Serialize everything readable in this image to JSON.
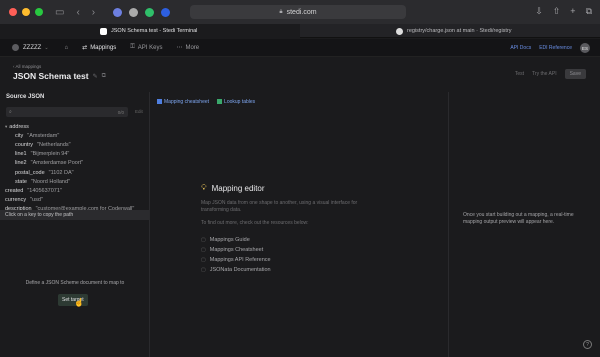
{
  "browser": {
    "url": "stedi.com",
    "tabs": [
      {
        "label": "JSON Schema test - Stedi Terminal"
      },
      {
        "label": "registry/charge.json at main · Stedi/registry"
      }
    ]
  },
  "app": {
    "org_name": "ZZZZZ",
    "nav": [
      {
        "label": "Mappings"
      },
      {
        "label": "API Keys"
      },
      {
        "label": "More"
      }
    ],
    "header_links": [
      {
        "label": "API Docs"
      },
      {
        "label": "EDI Reference"
      }
    ],
    "avatar_initials": "ES"
  },
  "page": {
    "breadcrumb": "All mappings",
    "title": "JSON Schema test",
    "actions": {
      "test": "Test",
      "try_api": "Try the API",
      "save": "Save"
    }
  },
  "source": {
    "title": "Source JSON",
    "search_count": "0/0",
    "edit": "Edit",
    "tree": [
      {
        "key": "address",
        "value": "",
        "level": 0,
        "caret": true
      },
      {
        "key": "city",
        "value": "\"Amsterdam\"",
        "level": 1
      },
      {
        "key": "country",
        "value": "\"Netherlands\"",
        "level": 1
      },
      {
        "key": "line1",
        "value": "\"Bijmerplein 94\"",
        "level": 1
      },
      {
        "key": "line2",
        "value": "\"Amsterdamse Poort\"",
        "level": 1
      },
      {
        "key": "postal_code",
        "value": "\"1102 DA\"",
        "level": 1
      },
      {
        "key": "state",
        "value": "\"Noord Holland\"",
        "level": 1
      },
      {
        "key": "created",
        "value": "\"1405637071\"",
        "level": 0
      },
      {
        "key": "currency",
        "value": "\"usd\"",
        "level": 0
      },
      {
        "key": "description",
        "value": "\"customer@example.com for Coderwall\"",
        "level": 0
      }
    ],
    "tooltip": "Click on a key to copy the path",
    "define_text": "Define a JSON Scheme document to map to",
    "set_target": "Set target"
  },
  "center": {
    "links": [
      {
        "label": "Mapping cheatsheet",
        "color": "#4f7fe0"
      },
      {
        "label": "Lookup tables",
        "color": "#3aa86b"
      }
    ],
    "editor_title": "Mapping editor",
    "editor_desc": "Map JSON data from one shape to another, using a visual interface for transforming data.",
    "editor_sub": "To find out more, check out the resources below:",
    "resources": [
      {
        "label": "Mappings Guide"
      },
      {
        "label": "Mappings Cheatsheet"
      },
      {
        "label": "Mappings API Reference"
      },
      {
        "label": "JSONata Documentation"
      }
    ]
  },
  "right": {
    "preview_text": "Once you start building out a mapping, a real-time mapping output preview will appear here."
  },
  "colors": {
    "accent_blue": "#6a8fe6",
    "set_target_bg": "#2d3a33"
  }
}
